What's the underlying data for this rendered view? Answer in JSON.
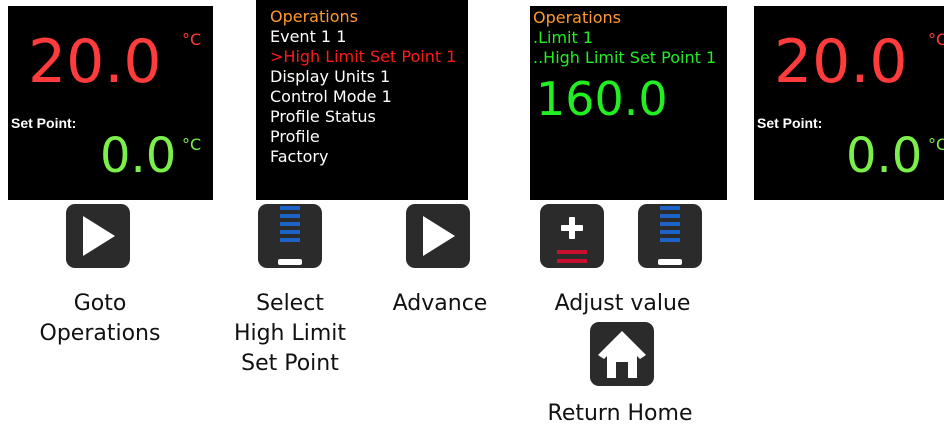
{
  "screen1": {
    "temperature": "20.0",
    "temp_unit": "°C",
    "setpoint_label": "Set Point:",
    "setpoint_value": "0.0",
    "setpoint_unit": "°C"
  },
  "screen2": {
    "menu": [
      "Operations",
      "Event 1 1",
      ">High Limit Set Point 1",
      "Display Units 1",
      "Control Mode 1",
      "Profile Status",
      "Profile",
      "Factory"
    ]
  },
  "screen3": {
    "line1": "Operations",
    "line2": ".Limit 1",
    "line3": "..High Limit Set Point 1",
    "value": "160.0"
  },
  "screen4": {
    "temperature": "20.0",
    "temp_unit": "°C",
    "setpoint_label": "Set Point:",
    "setpoint_value": "0.0",
    "setpoint_unit": "°C"
  },
  "buttons": {
    "goto": "play-icon",
    "select": "down-icon",
    "advance": "play-icon",
    "plus": "plus-icon",
    "minus": "down-icon",
    "home": "home-icon"
  },
  "captions": {
    "goto": [
      "Goto",
      "Operations"
    ],
    "select": [
      "Select",
      "High Limit",
      "Set Point"
    ],
    "advance": "Advance",
    "adjust": "Adjust value",
    "home": "Return Home"
  },
  "colors": {
    "temp": "#ff3b3b",
    "setpoint": "#7cf04a",
    "menu_header": "#ff9a2e",
    "menu_selected": "#ff1a1a",
    "green_text": "#22ee22",
    "minus_accent": "#1e63c8",
    "plus_accent": "#c8102e"
  }
}
